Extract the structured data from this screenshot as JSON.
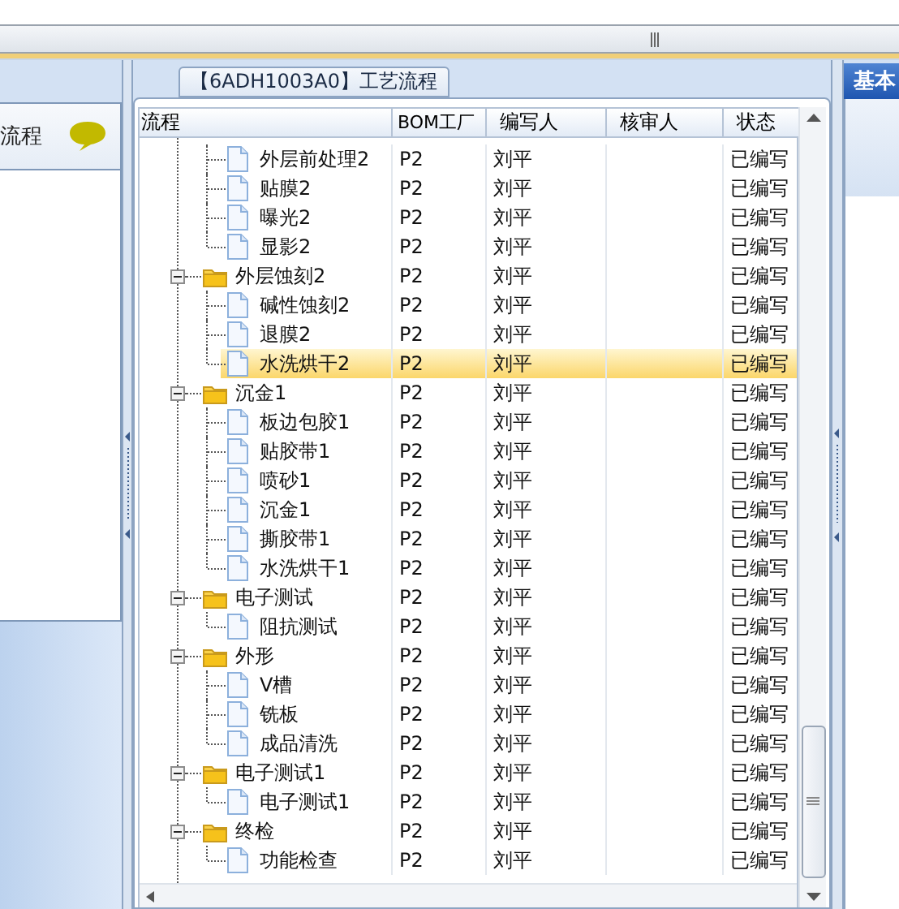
{
  "left_panel": {
    "title": "流程"
  },
  "tab": {
    "title": "【6ADH1003A0】工艺流程"
  },
  "right_panel": {
    "title": "基本"
  },
  "table": {
    "columns": [
      "流程",
      "BOM工厂",
      "编写人",
      "核审人",
      "状态"
    ],
    "groups": [
      {
        "children": [
          {
            "name": "外层前处理2",
            "bom": "P2",
            "writer": "刘平",
            "status": "已编写",
            "selected": false
          },
          {
            "name": "贴膜2",
            "bom": "P2",
            "writer": "刘平",
            "status": "已编写",
            "selected": false
          },
          {
            "name": "曝光2",
            "bom": "P2",
            "writer": "刘平",
            "status": "已编写",
            "selected": false
          },
          {
            "name": "显影2",
            "bom": "P2",
            "writer": "刘平",
            "status": "已编写",
            "selected": false
          }
        ]
      },
      {
        "name": "外层蚀刻2",
        "bom": "P2",
        "writer": "刘平",
        "status": "已编写",
        "selected": false,
        "expanded": true,
        "children": [
          {
            "name": "碱性蚀刻2",
            "bom": "P2",
            "writer": "刘平",
            "status": "已编写",
            "selected": false
          },
          {
            "name": "退膜2",
            "bom": "P2",
            "writer": "刘平",
            "status": "已编写",
            "selected": false
          },
          {
            "name": "水洗烘干2",
            "bom": "P2",
            "writer": "刘平",
            "status": "已编写",
            "selected": true
          }
        ]
      },
      {
        "name": "沉金1",
        "bom": "P2",
        "writer": "刘平",
        "status": "已编写",
        "selected": false,
        "expanded": true,
        "children": [
          {
            "name": "板边包胶1",
            "bom": "P2",
            "writer": "刘平",
            "status": "已编写",
            "selected": false
          },
          {
            "name": "贴胶带1",
            "bom": "P2",
            "writer": "刘平",
            "status": "已编写",
            "selected": false
          },
          {
            "name": "喷砂1",
            "bom": "P2",
            "writer": "刘平",
            "status": "已编写",
            "selected": false
          },
          {
            "name": "沉金1",
            "bom": "P2",
            "writer": "刘平",
            "status": "已编写",
            "selected": false
          },
          {
            "name": "撕胶带1",
            "bom": "P2",
            "writer": "刘平",
            "status": "已编写",
            "selected": false
          },
          {
            "name": "水洗烘干1",
            "bom": "P2",
            "writer": "刘平",
            "status": "已编写",
            "selected": false
          }
        ]
      },
      {
        "name": "电子测试",
        "bom": "P2",
        "writer": "刘平",
        "status": "已编写",
        "selected": false,
        "expanded": true,
        "children": [
          {
            "name": "阻抗测试",
            "bom": "P2",
            "writer": "刘平",
            "status": "已编写",
            "selected": false
          }
        ]
      },
      {
        "name": "外形",
        "bom": "P2",
        "writer": "刘平",
        "status": "已编写",
        "selected": false,
        "expanded": true,
        "children": [
          {
            "name": "V槽",
            "bom": "P2",
            "writer": "刘平",
            "status": "已编写",
            "selected": false
          },
          {
            "name": "铣板",
            "bom": "P2",
            "writer": "刘平",
            "status": "已编写",
            "selected": false
          },
          {
            "name": "成品清洗",
            "bom": "P2",
            "writer": "刘平",
            "status": "已编写",
            "selected": false
          }
        ]
      },
      {
        "name": "电子测试1",
        "bom": "P2",
        "writer": "刘平",
        "status": "已编写",
        "selected": false,
        "expanded": true,
        "children": [
          {
            "name": "电子测试1",
            "bom": "P2",
            "writer": "刘平",
            "status": "已编写",
            "selected": false
          }
        ]
      },
      {
        "name": "终检",
        "bom": "P2",
        "writer": "刘平",
        "status": "已编写",
        "selected": false,
        "expanded": true,
        "children": [
          {
            "name": "功能检查",
            "bom": "P2",
            "writer": "刘平",
            "status": "已编写",
            "selected": false
          }
        ]
      }
    ]
  }
}
